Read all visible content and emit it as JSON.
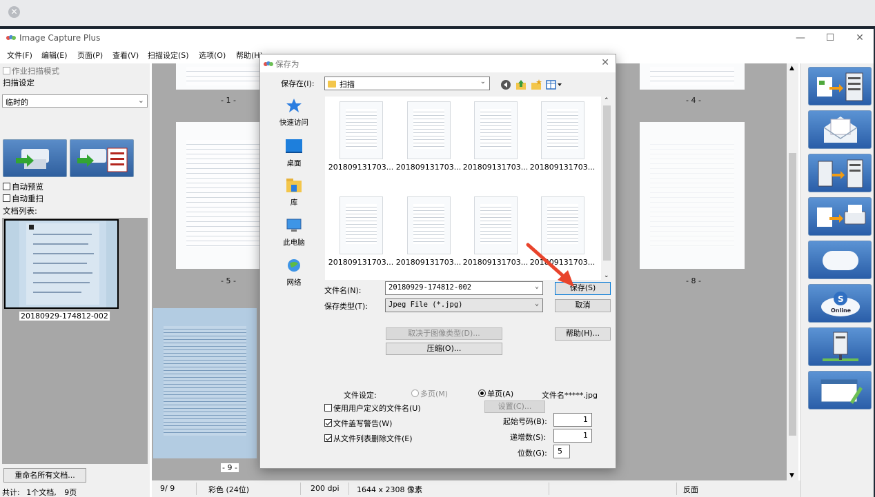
{
  "app": {
    "title": "Image Capture Plus",
    "menu": [
      "文件(F)",
      "编辑(E)",
      "页面(P)",
      "查看(V)",
      "扫描设定(S)",
      "选项(O)",
      "帮助(H)"
    ],
    "min_symbol": "—",
    "max_symbol": "☐",
    "close_symbol": "✕"
  },
  "left_panel": {
    "batch_mode_label": "作业扫描模式",
    "scan_settings_label": "扫描设定",
    "profile_value": "临时的",
    "auto_preview_label": "自动预览",
    "auto_rescan_label": "自动重扫",
    "doc_list_label": "文档列表:",
    "doc_name": "20180929-174812-002",
    "rename_all_button": "重命名所有文档...",
    "totals_label": "共计:",
    "totals_docs": "1个文档,",
    "totals_pages": "9页"
  },
  "center": {
    "page_labels": [
      "- 1 -",
      "- 4 -",
      "- 5 -",
      "- 8 -",
      "- 9 -"
    ]
  },
  "status_bar": {
    "page": "9/  9",
    "color_mode": "彩色 (24位)",
    "dpi": "200 dpi",
    "size": "1644 x 2308 像素",
    "side": "反面"
  },
  "dialog": {
    "title": "保存为",
    "save_in_label": "保存在(I):",
    "save_in_value": "扫描",
    "places": [
      {
        "label": "快速访问",
        "icon": "star-icon"
      },
      {
        "label": "桌面",
        "icon": "desktop-icon"
      },
      {
        "label": "库",
        "icon": "library-folder-icon"
      },
      {
        "label": "此电脑",
        "icon": "computer-icon"
      },
      {
        "label": "网络",
        "icon": "network-icon"
      }
    ],
    "files": [
      "201809131703...",
      "201809131703...",
      "201809131703...",
      "201809131703...",
      "201809131703...",
      "201809131703...",
      "201809131703...",
      "201809131703..."
    ],
    "filename_label": "文件名(N):",
    "filename_value": "20180929-174812-002",
    "filetype_label": "保存类型(T):",
    "filetype_value": "Jpeg File (*.jpg)",
    "save_button": "保存(S)",
    "cancel_button": "取消",
    "help_button": "帮助(H)...",
    "depends_on_type_button": "取决于图像类型(D)...",
    "compress_button": "压缩(O)...",
    "file_settings_label": "文件设定:",
    "multipage_label": "多页(M)",
    "singlepage_label": "单页(A)",
    "filename_pattern": "文件名*****.jpg",
    "use_custom_name_label": "使用用户定义的文件名(U)",
    "settings_button": "设置(C)...",
    "overwrite_warning_label": "文件盖写警告(W)",
    "remove_from_list_label": "从文件列表删除文件(E)",
    "start_number_label": "起始号码(B):",
    "start_number_value": "1",
    "increment_label": "递增数(S):",
    "increment_value": "1",
    "digits_label": "位数(G):",
    "digits_value": "5"
  },
  "colors": {
    "accent_blue": "#0078d7",
    "annotation_arrow": "#e8442c",
    "workspace_gray": "#a9a9a9"
  }
}
